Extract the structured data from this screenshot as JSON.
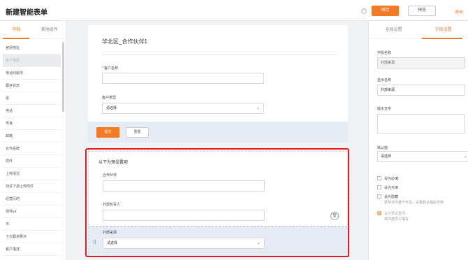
{
  "header": {
    "title": "新建智能表单",
    "help_glyph": "?",
    "save_label": "保存",
    "preview_label": "预览",
    "exit_label": "退出"
  },
  "left_panel": {
    "tabs": [
      "字段",
      "其他组件"
    ],
    "fields": [
      "官网地址",
      "客户类型",
      "电话归属市",
      "跟进状态",
      "省",
      "电话",
      "传真",
      "邮箱",
      "合作品牌",
      "附件",
      "上传情况",
      "测试下游上传附件",
      "经营历时",
      "附件ya",
      "市",
      "下次跟进要点",
      "客户描述"
    ]
  },
  "form": {
    "title": "华北区_合作伙伴1",
    "customer_name_label": "客户名称",
    "customer_type_label": "客户类型",
    "select_placeholder": "请选择",
    "submit_label": "提交",
    "reset_label": "重置"
  },
  "preset": {
    "title": "以下为预设置项",
    "partner_label": "合作伙伴",
    "owner_label": "外部负责人",
    "source_label": "外部来源",
    "source_value": "请选择"
  },
  "right_panel": {
    "tabs": [
      "全局设置",
      "字段设置"
    ],
    "field_name_label": "字段名称",
    "field_name_value": "外部来源",
    "display_name_label": "显示名称",
    "display_name_value": "外部来源",
    "hint_label": "提示文字",
    "default_label": "默认值",
    "default_value": "请选择",
    "required_label": "设为必填",
    "readonly_label": "设为只读",
    "hidden_label": "设为隐藏",
    "hidden_hint": "表单访问者不可见，设置默认值后可用",
    "preset_label": "设为预设置项",
    "preset_hint": "供内部员工填写"
  },
  "colors": {
    "accent": "#f47b25",
    "highlight_frame": "#e02020"
  }
}
